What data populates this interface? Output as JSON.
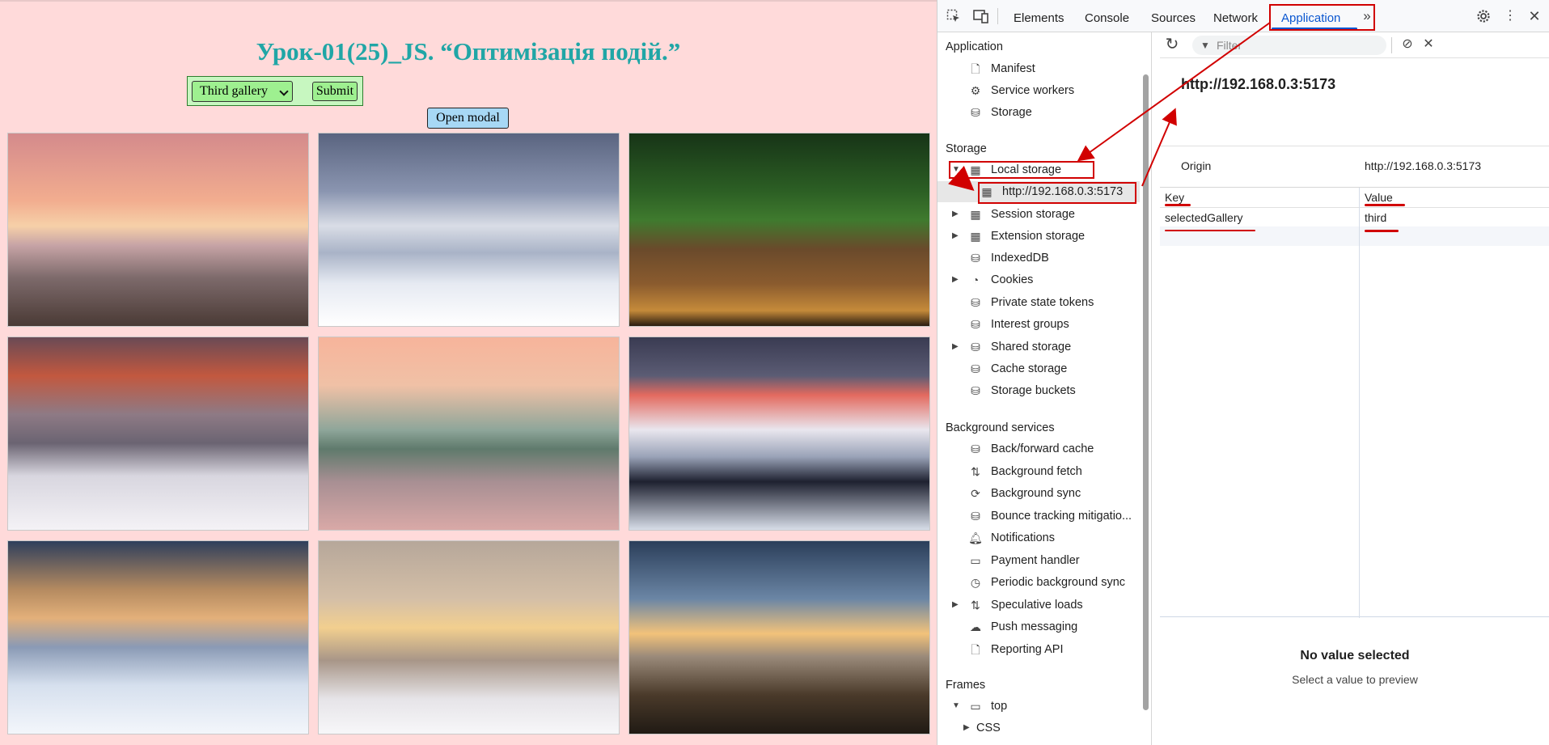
{
  "page": {
    "title": "Урок-01(25)_JS. “Оптимізація подій.”",
    "gallery_select": {
      "value": "Third gallery"
    },
    "submit_label": "Submit",
    "open_modal_label": "Open modal"
  },
  "devtools": {
    "tabs": [
      "Elements",
      "Console",
      "Sources",
      "Network",
      "Application"
    ],
    "active_tab": "Application",
    "more_tabs_icon": "chevron-double-right-icon",
    "sidebar": {
      "application_header": "Application",
      "application_items": [
        "Manifest",
        "Service workers",
        "Storage"
      ],
      "storage_header": "Storage",
      "storage_items": [
        "Local storage",
        "http://192.168.0.3:5173",
        "Session storage",
        "Extension storage",
        "IndexedDB",
        "Cookies",
        "Private state tokens",
        "Interest groups",
        "Shared storage",
        "Cache storage",
        "Storage buckets"
      ],
      "background_header": "Background services",
      "background_items": [
        "Back/forward cache",
        "Background fetch",
        "Background sync",
        "Bounce tracking mitigatio...",
        "Notifications",
        "Payment handler",
        "Periodic background sync",
        "Speculative loads",
        "Push messaging",
        "Reporting API"
      ],
      "frames_header": "Frames",
      "frames_items": [
        "top",
        "CSS"
      ]
    },
    "main": {
      "filter_placeholder": "Filter",
      "origin_title": "http://192.168.0.3:5173",
      "origin_label": "Origin",
      "origin_value": "http://192.168.0.3:5173",
      "table": {
        "columns": [
          "Key",
          "Value"
        ],
        "rows": [
          {
            "key": "selectedGallery",
            "value": "third"
          }
        ]
      },
      "empty_title": "No value selected",
      "empty_subtitle": "Select a value to preview"
    },
    "accent_color": "#0b57d0",
    "annotation_color": "#d10000"
  }
}
